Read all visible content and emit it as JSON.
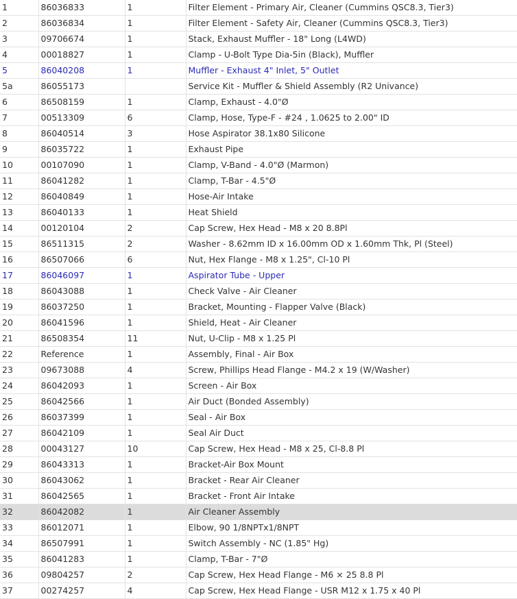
{
  "colors": {
    "text": "#333333",
    "link": "#2a2ab4",
    "highlight_row": "#dcdcdc",
    "grid": "#e2e2e2"
  },
  "rows": [
    {
      "item": "1",
      "part": "86036833",
      "qty": "1",
      "desc": "Filter Element - Primary Air, Cleaner (Cummins QSC8.3, Tier3)",
      "link": false,
      "highlight": false
    },
    {
      "item": "2",
      "part": "86036834",
      "qty": "1",
      "desc": "Filter Element - Safety Air, Cleaner (Cummins QSC8.3, Tier3)",
      "link": false,
      "highlight": false
    },
    {
      "item": "3",
      "part": "09706674",
      "qty": "1",
      "desc": "Stack, Exhaust Muffler - 18\" Long (L4WD)",
      "link": false,
      "highlight": false
    },
    {
      "item": "4",
      "part": "00018827",
      "qty": "1",
      "desc": "Clamp - U-Bolt Type Dia-5in (Black), Muffler",
      "link": false,
      "highlight": false
    },
    {
      "item": "5",
      "part": "86040208",
      "qty": "1",
      "desc": "Muffler - Exhaust 4\" Inlet, 5\" Outlet",
      "link": true,
      "highlight": false
    },
    {
      "item": "5a",
      "part": "86055173",
      "qty": "",
      "desc": "Service Kit - Muffler & Shield Assembly (R2 Univance)",
      "link": false,
      "highlight": false
    },
    {
      "item": "6",
      "part": "86508159",
      "qty": "1",
      "desc": "Clamp, Exhaust - 4.0\"Ø",
      "link": false,
      "highlight": false
    },
    {
      "item": "7",
      "part": "00513309",
      "qty": "6",
      "desc": "Clamp, Hose, Type-F - #24 , 1.0625 to 2.00\" ID",
      "link": false,
      "highlight": false
    },
    {
      "item": "8",
      "part": "86040514",
      "qty": "3",
      "desc": "Hose Aspirator 38.1x80 Silicone",
      "link": false,
      "highlight": false
    },
    {
      "item": "9",
      "part": "86035722",
      "qty": "1",
      "desc": "Exhaust Pipe",
      "link": false,
      "highlight": false
    },
    {
      "item": "10",
      "part": "00107090",
      "qty": "1",
      "desc": "Clamp, V-Band - 4.0\"Ø (Marmon)",
      "link": false,
      "highlight": false
    },
    {
      "item": "11",
      "part": "86041282",
      "qty": "1",
      "desc": "Clamp, T-Bar - 4.5\"Ø",
      "link": false,
      "highlight": false
    },
    {
      "item": "12",
      "part": "86040849",
      "qty": "1",
      "desc": "Hose-Air Intake",
      "link": false,
      "highlight": false
    },
    {
      "item": "13",
      "part": "86040133",
      "qty": "1",
      "desc": "Heat Shield",
      "link": false,
      "highlight": false
    },
    {
      "item": "14",
      "part": "00120104",
      "qty": "2",
      "desc": "Cap Screw, Hex Head - M8 x 20 8.8Pl",
      "link": false,
      "highlight": false
    },
    {
      "item": "15",
      "part": "86511315",
      "qty": "2",
      "desc": "Washer - 8.62mm ID x 16.00mm OD x 1.60mm Thk, Pl (Steel)",
      "link": false,
      "highlight": false
    },
    {
      "item": "16",
      "part": "86507066",
      "qty": "6",
      "desc": "Nut, Hex Flange - M8 x 1.25\", Cl-10 Pl",
      "link": false,
      "highlight": false
    },
    {
      "item": "17",
      "part": "86046097",
      "qty": "1",
      "desc": "Aspirator Tube - Upper",
      "link": true,
      "highlight": false
    },
    {
      "item": "18",
      "part": "86043088",
      "qty": "1",
      "desc": "Check Valve - Air Cleaner",
      "link": false,
      "highlight": false
    },
    {
      "item": "19",
      "part": "86037250",
      "qty": "1",
      "desc": "Bracket, Mounting - Flapper Valve (Black)",
      "link": false,
      "highlight": false
    },
    {
      "item": "20",
      "part": "86041596",
      "qty": "1",
      "desc": "Shield, Heat - Air Cleaner",
      "link": false,
      "highlight": false
    },
    {
      "item": "21",
      "part": "86508354",
      "qty": "11",
      "desc": "Nut, U-Clip - M8 x 1.25 Pl",
      "link": false,
      "highlight": false
    },
    {
      "item": "22",
      "part": "Reference",
      "qty": "1",
      "desc": "Assembly, Final - Air Box",
      "link": false,
      "highlight": false
    },
    {
      "item": "23",
      "part": "09673088",
      "qty": "4",
      "desc": "Screw, Phillips Head Flange - M4.2 x 19 (W/Washer)",
      "link": false,
      "highlight": false
    },
    {
      "item": "24",
      "part": "86042093",
      "qty": "1",
      "desc": "Screen - Air Box",
      "link": false,
      "highlight": false
    },
    {
      "item": "25",
      "part": "86042566",
      "qty": "1",
      "desc": "Air Duct (Bonded Assembly)",
      "link": false,
      "highlight": false
    },
    {
      "item": "26",
      "part": "86037399",
      "qty": "1",
      "desc": "Seal - Air Box",
      "link": false,
      "highlight": false
    },
    {
      "item": "27",
      "part": "86042109",
      "qty": "1",
      "desc": "Seal Air Duct",
      "link": false,
      "highlight": false
    },
    {
      "item": "28",
      "part": "00043127",
      "qty": "10",
      "desc": "Cap Screw, Hex Head - M8 x 25, Cl-8.8 Pl",
      "link": false,
      "highlight": false
    },
    {
      "item": "29",
      "part": "86043313",
      "qty": "1",
      "desc": "Bracket-Air Box Mount",
      "link": false,
      "highlight": false
    },
    {
      "item": "30",
      "part": "86043062",
      "qty": "1",
      "desc": "Bracket - Rear Air Cleaner",
      "link": false,
      "highlight": false
    },
    {
      "item": "31",
      "part": "86042565",
      "qty": "1",
      "desc": "Bracket - Front Air Intake",
      "link": false,
      "highlight": false
    },
    {
      "item": "32",
      "part": "86042082",
      "qty": "1",
      "desc": "Air Cleaner Assembly",
      "link": false,
      "highlight": true
    },
    {
      "item": "33",
      "part": "86012071",
      "qty": "1",
      "desc": "Elbow, 90 1/8NPTx1/8NPT",
      "link": false,
      "highlight": false
    },
    {
      "item": "34",
      "part": "86507991",
      "qty": "1",
      "desc": "Switch Assembly - NC (1.85\" Hg)",
      "link": false,
      "highlight": false
    },
    {
      "item": "35",
      "part": "86041283",
      "qty": "1",
      "desc": "Clamp, T-Bar - 7\"Ø",
      "link": false,
      "highlight": false
    },
    {
      "item": "36",
      "part": "09804257",
      "qty": "2",
      "desc": "Cap Screw, Hex Head Flange - M6 × 25 8.8 Pl",
      "link": false,
      "highlight": false
    },
    {
      "item": "37",
      "part": "00274257",
      "qty": "4",
      "desc": "Cap Screw, Hex Head Flange - USR M12 x 1.75 x 40 Pl",
      "link": false,
      "highlight": false
    }
  ]
}
